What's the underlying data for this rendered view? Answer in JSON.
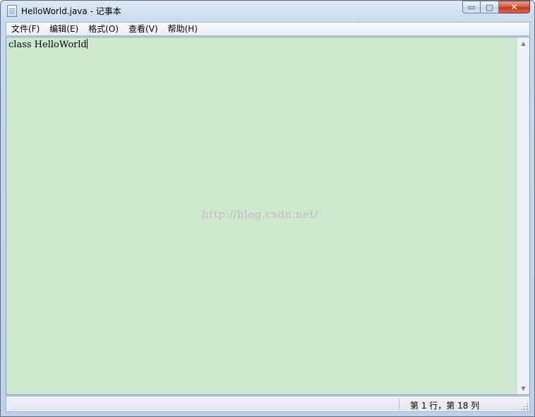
{
  "window": {
    "title": "HelloWorld.java - 记事本",
    "controls": {
      "minimize": "▭",
      "maximize": "□",
      "close": "✕"
    }
  },
  "menu": {
    "items": [
      {
        "label": "文件(F)"
      },
      {
        "label": "编辑(E)"
      },
      {
        "label": "格式(O)"
      },
      {
        "label": "查看(V)"
      },
      {
        "label": "帮助(H)"
      }
    ]
  },
  "editor": {
    "content": "class HelloWorld",
    "watermark": "http://blog.csdn.net/",
    "background": "#cce8cf"
  },
  "scrollbar": {
    "up_icon": "▲",
    "down_icon": "▼"
  },
  "status": {
    "position": "第 1 行，第 18 列"
  }
}
